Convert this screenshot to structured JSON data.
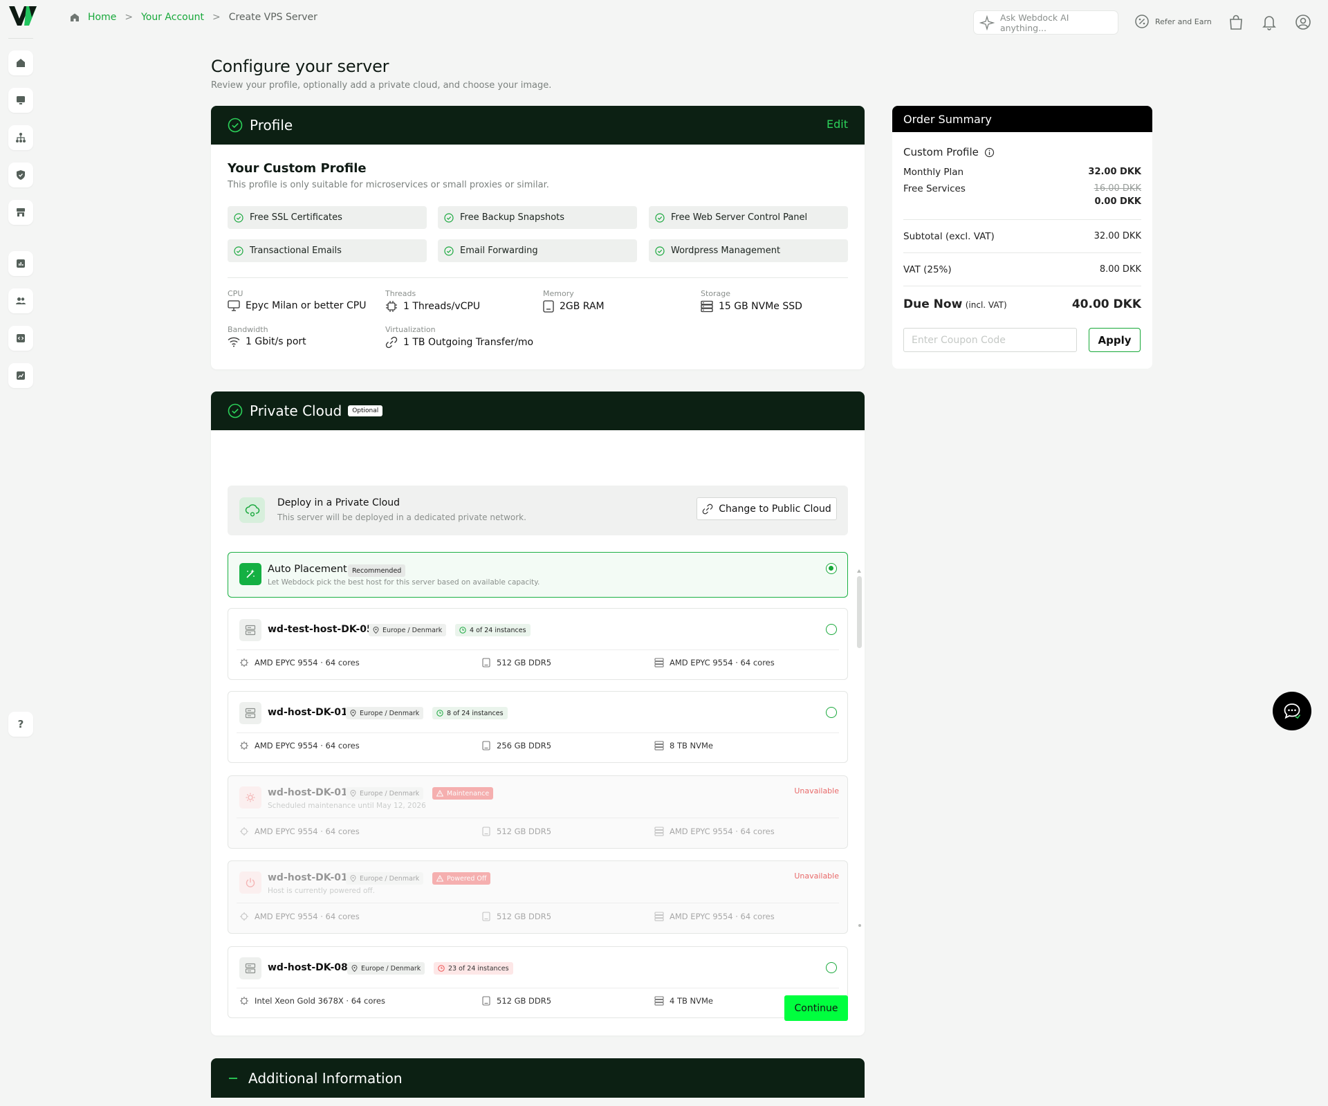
{
  "breadcrumb": {
    "home": "Home",
    "account": "Your Account",
    "current": "Create VPS Server",
    "separator": ">"
  },
  "topbar": {
    "ai_placeholder": "Ask Webdock AI anything...",
    "refer_label": "Refer and Earn"
  },
  "page": {
    "title": "Configure your server",
    "subtitle": "Review your profile, optionally add a private cloud, and choose your image."
  },
  "profile": {
    "header": "Profile",
    "edit_label": "Edit",
    "name": "Your Custom Profile",
    "description": "This profile is only suitable for microservices or small proxies or similar.",
    "features": [
      "Free SSL Certificates",
      "Free Backup Snapshots",
      "Free Web Server Control Panel",
      "Transactional Emails",
      "Email Forwarding",
      "Wordpress Management"
    ],
    "specs": [
      {
        "label": "CPU",
        "value": "Epyc Milan or better CPU",
        "icon": "monitor-icon"
      },
      {
        "label": "Threads",
        "value": "1 Threads/vCPU",
        "icon": "cpu-icon"
      },
      {
        "label": "Memory",
        "value": "2GB RAM",
        "icon": "memory-icon"
      },
      {
        "label": "Storage",
        "value": "15 GB NVMe SSD",
        "icon": "storage-icon"
      },
      {
        "label": "Bandwidth",
        "value": "1 Gbit/s port",
        "icon": "wifi-icon"
      },
      {
        "label": "Virtualization",
        "value": "1 TB Outgoing Transfer/mo",
        "icon": "transfer-icon"
      }
    ]
  },
  "summary": {
    "header": "Order Summary",
    "profile_name": "Custom Profile",
    "monthly_label": "Monthly Plan",
    "monthly_value": "32.00 DKK",
    "free_label": "Free Services",
    "free_old": "16.00 DKK",
    "free_value": "0.00 DKK",
    "subtotal_label": "Subtotal (excl. VAT)",
    "subtotal_value": "32.00 DKK",
    "vat_label": "VAT (25%)",
    "vat_value": "8.00 DKK",
    "due_label": "Due Now",
    "due_note": "(incl. VAT)",
    "due_value": "40.00 DKK",
    "coupon_placeholder": "Enter Coupon Code",
    "apply_label": "Apply"
  },
  "private_cloud": {
    "header": "Private Cloud",
    "badge": "Optional",
    "deploy_title": "Deploy in a Private Cloud",
    "deploy_sub": "This server will be deployed in a dedicated private network.",
    "change_label": "Change to Public Cloud",
    "auto": {
      "name": "Auto Placement",
      "badge": "Recommended",
      "desc": "Let Webdock pick the best host for this server based on available capacity.",
      "selected": true
    },
    "hosts": [
      {
        "name": "wd-test-host-DK-05",
        "region": "Europe / Denmark",
        "status": "4 of 24 instances",
        "cpu": "AMD EPYC 9554 · 64 cores",
        "ram": "512 GB DDR5",
        "storage": "AMD EPYC 9554 · 64 cores"
      },
      {
        "name": "wd-host-DK-01",
        "region": "Europe / Denmark",
        "status": "8 of 24 instances",
        "cpu": "AMD EPYC 9554 · 64 cores",
        "ram": "256 GB DDR5",
        "storage": "8 TB NVMe"
      },
      {
        "name": "wd-host-DK-01",
        "region": "Europe / Denmark",
        "status": "Maintenance",
        "desc": "Scheduled maintenance until May 12, 2026",
        "unavailable": "Unavailable",
        "cpu": "AMD EPYC 9554 · 64 cores",
        "ram": "512 GB DDR5",
        "storage": "AMD EPYC 9554 · 64 cores"
      },
      {
        "name": "wd-host-DK-01",
        "region": "Europe / Denmark",
        "status": "Powered Off",
        "desc": "Host is currently powered off.",
        "unavailable": "Unavailable",
        "cpu": "AMD EPYC 9554 · 64 cores",
        "ram": "512 GB DDR5",
        "storage": "AMD EPYC 9554 · 64 cores"
      },
      {
        "name": "wd-host-DK-08",
        "region": "Europe / Denmark",
        "status": "23 of 24 instances",
        "cpu": "Intel Xeon Gold 3678X · 64 cores",
        "ram": "512 GB DDR5",
        "storage": "4 TB NVMe"
      }
    ],
    "continue_label": "Continue"
  },
  "additional": {
    "header": "Additional Information"
  },
  "colors": {
    "brand_green": "#17a83a",
    "dark_header": "#0c2013",
    "continue_green": "#00ff3e",
    "error_red": "#ef4a4a"
  }
}
